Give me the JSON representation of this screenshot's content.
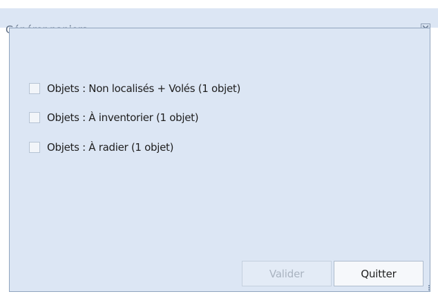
{
  "window": {
    "title": "Générer paniers"
  },
  "options": [
    {
      "label": "Objets : Non localisés + Volés (1 objet)",
      "checked": false
    },
    {
      "label": "Objets : À inventorier (1 objet)",
      "checked": false
    },
    {
      "label": "Objets : À radier (1 objet)",
      "checked": false
    }
  ],
  "buttons": {
    "validate_label": "Valider",
    "validate_enabled": false,
    "quit_label": "Quitter"
  },
  "icons": {
    "close": "close-icon",
    "checkbox": "checkbox-icon",
    "resize": "resize-grip-icon"
  },
  "colors": {
    "window_background": "#dce6f4",
    "title_text": "#5a6a80",
    "disabled_text": "#a9b3c0"
  }
}
